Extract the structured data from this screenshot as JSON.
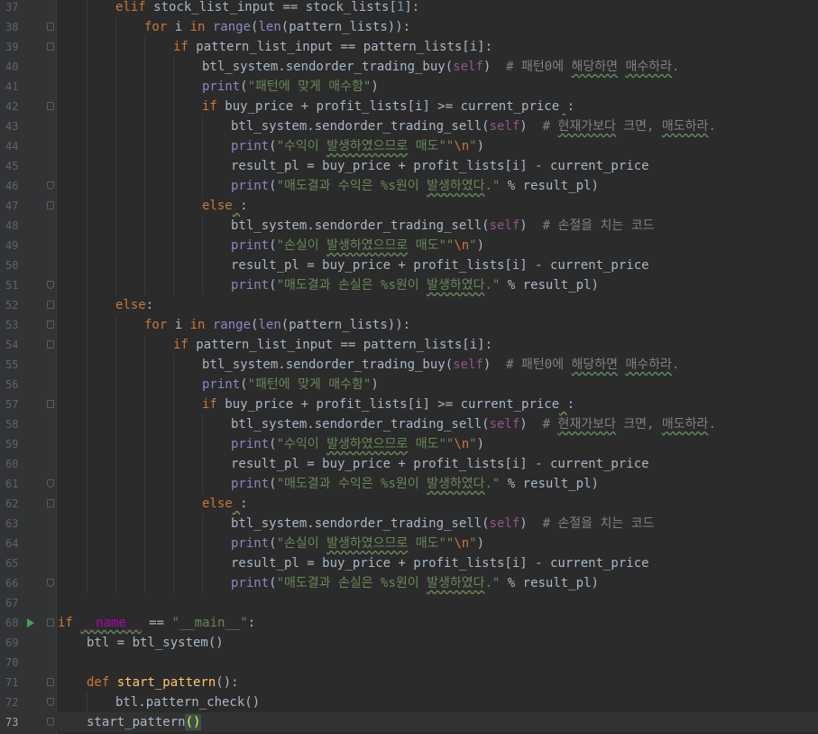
{
  "editor": {
    "lines": [
      {
        "num": "37",
        "indent": 2,
        "fold": "none",
        "tokens": [
          [
            "kw",
            "elif "
          ],
          [
            "",
            "stock_list_input == stock_lists["
          ],
          [
            "num",
            "1"
          ],
          [
            "",
            "]:"
          ]
        ]
      },
      {
        "num": "38",
        "indent": 3,
        "fold": "open",
        "tokens": [
          [
            "kw",
            "for "
          ],
          [
            "",
            "i "
          ],
          [
            "kw",
            "in "
          ],
          [
            "bi",
            "range"
          ],
          [
            "",
            "("
          ],
          [
            "bi",
            "len"
          ],
          [
            "",
            "(pattern_lists)):"
          ]
        ]
      },
      {
        "num": "39",
        "indent": 4,
        "fold": "open",
        "tokens": [
          [
            "kw",
            "if "
          ],
          [
            "",
            "pattern_list_input == pattern_lists[i]:"
          ]
        ]
      },
      {
        "num": "40",
        "indent": 5,
        "fold": "none",
        "tokens": [
          [
            "",
            "btl_system.sendorder_trading_buy("
          ],
          [
            "self",
            "self"
          ],
          [
            "",
            ")  "
          ],
          [
            "cmt",
            "# 패턴0에 "
          ],
          [
            "cmtu",
            "해당하면"
          ],
          [
            "cmt",
            " "
          ],
          [
            "cmtu",
            "매수하라"
          ],
          [
            "cmt",
            "."
          ]
        ]
      },
      {
        "num": "41",
        "indent": 5,
        "fold": "none",
        "tokens": [
          [
            "bi",
            "print"
          ],
          [
            "",
            "("
          ],
          [
            "str",
            "\"패턴에 맞게 매수함\""
          ],
          [
            "",
            ")"
          ]
        ]
      },
      {
        "num": "42",
        "indent": 5,
        "fold": "open",
        "tokens": [
          [
            "kw",
            "if "
          ],
          [
            "",
            "buy_price + profit_lists[i] >= current_price"
          ],
          [
            "warn",
            " "
          ],
          [
            "",
            ":"
          ]
        ]
      },
      {
        "num": "43",
        "indent": 6,
        "fold": "none",
        "tokens": [
          [
            "",
            "btl_system.sendorder_trading_sell("
          ],
          [
            "self",
            "self"
          ],
          [
            "",
            ")  "
          ],
          [
            "cmt",
            "# "
          ],
          [
            "cmtu",
            "현재가보다"
          ],
          [
            "cmt",
            " 크면, "
          ],
          [
            "cmtu",
            "매도하라"
          ],
          [
            "cmt",
            "."
          ]
        ]
      },
      {
        "num": "44",
        "indent": 6,
        "fold": "none",
        "tokens": [
          [
            "bi",
            "print"
          ],
          [
            "",
            "("
          ],
          [
            "str",
            "\"수익이 "
          ],
          [
            "stru",
            "발생하였으므로"
          ],
          [
            "str",
            " 매도\"\""
          ],
          [
            "esc",
            "\\n"
          ],
          [
            "str",
            "\""
          ],
          [
            "",
            ")"
          ]
        ]
      },
      {
        "num": "45",
        "indent": 6,
        "fold": "none",
        "tokens": [
          [
            "",
            "result_pl = buy_price + profit_lists[i] - current_price"
          ]
        ]
      },
      {
        "num": "46",
        "indent": 6,
        "fold": "end",
        "tokens": [
          [
            "bi",
            "print"
          ],
          [
            "",
            "("
          ],
          [
            "str",
            "\"매도결과 수익은 %s원이 "
          ],
          [
            "stru",
            "발생하였다"
          ],
          [
            "str",
            ".\""
          ],
          [
            "",
            " % result_pl)"
          ]
        ]
      },
      {
        "num": "47",
        "indent": 5,
        "fold": "open",
        "tokens": [
          [
            "kw",
            "else"
          ],
          [
            "warn",
            " "
          ],
          [
            "",
            ":"
          ]
        ]
      },
      {
        "num": "48",
        "indent": 6,
        "fold": "none",
        "tokens": [
          [
            "",
            "btl_system.sendorder_trading_sell("
          ],
          [
            "self",
            "self"
          ],
          [
            "",
            ")  "
          ],
          [
            "cmt",
            "# 손절을 치는 코드"
          ]
        ]
      },
      {
        "num": "49",
        "indent": 6,
        "fold": "none",
        "tokens": [
          [
            "bi",
            "print"
          ],
          [
            "",
            "("
          ],
          [
            "str",
            "\"손실이 "
          ],
          [
            "stru",
            "발생하였으므로"
          ],
          [
            "str",
            " 매도\"\""
          ],
          [
            "esc",
            "\\n"
          ],
          [
            "str",
            "\""
          ],
          [
            "",
            ")"
          ]
        ]
      },
      {
        "num": "50",
        "indent": 6,
        "fold": "none",
        "tokens": [
          [
            "",
            "result_pl = buy_price + profit_lists[i] - current_price"
          ]
        ]
      },
      {
        "num": "51",
        "indent": 6,
        "fold": "end",
        "tokens": [
          [
            "bi",
            "print"
          ],
          [
            "",
            "("
          ],
          [
            "str",
            "\"매도결과 손실은 %s원이 "
          ],
          [
            "stru",
            "발생하였다"
          ],
          [
            "str",
            ".\""
          ],
          [
            "",
            " % result_pl)"
          ]
        ]
      },
      {
        "num": "52",
        "indent": 2,
        "fold": "open",
        "tokens": [
          [
            "kw",
            "else"
          ],
          [
            "",
            ":"
          ]
        ]
      },
      {
        "num": "53",
        "indent": 3,
        "fold": "open",
        "tokens": [
          [
            "kw",
            "for "
          ],
          [
            "",
            "i "
          ],
          [
            "kw",
            "in "
          ],
          [
            "bi",
            "range"
          ],
          [
            "",
            "("
          ],
          [
            "bi",
            "len"
          ],
          [
            "",
            "(pattern_lists)):"
          ]
        ]
      },
      {
        "num": "54",
        "indent": 4,
        "fold": "open",
        "tokens": [
          [
            "kw",
            "if "
          ],
          [
            "",
            "pattern_list_input == pattern_lists[i]:"
          ]
        ]
      },
      {
        "num": "55",
        "indent": 5,
        "fold": "none",
        "tokens": [
          [
            "",
            "btl_system.sendorder_trading_buy("
          ],
          [
            "self",
            "self"
          ],
          [
            "",
            ")  "
          ],
          [
            "cmt",
            "# 패턴0에 "
          ],
          [
            "cmtu",
            "해당하면"
          ],
          [
            "cmt",
            " "
          ],
          [
            "cmtu",
            "매수하라"
          ],
          [
            "cmt",
            "."
          ]
        ]
      },
      {
        "num": "56",
        "indent": 5,
        "fold": "none",
        "tokens": [
          [
            "bi",
            "print"
          ],
          [
            "",
            "("
          ],
          [
            "str",
            "\"패턴에 맞게 매수함\""
          ],
          [
            "",
            ")"
          ]
        ]
      },
      {
        "num": "57",
        "indent": 5,
        "fold": "open",
        "tokens": [
          [
            "kw",
            "if "
          ],
          [
            "",
            "buy_price + profit_lists[i] >= current_price"
          ],
          [
            "warn",
            " "
          ],
          [
            "",
            ":"
          ]
        ]
      },
      {
        "num": "58",
        "indent": 6,
        "fold": "none",
        "tokens": [
          [
            "",
            "btl_system.sendorder_trading_sell("
          ],
          [
            "self",
            "self"
          ],
          [
            "",
            ")  "
          ],
          [
            "cmt",
            "# "
          ],
          [
            "cmtu",
            "현재가보다"
          ],
          [
            "cmt",
            " 크면, "
          ],
          [
            "cmtu",
            "매도하라"
          ],
          [
            "cmt",
            "."
          ]
        ]
      },
      {
        "num": "59",
        "indent": 6,
        "fold": "none",
        "tokens": [
          [
            "bi",
            "print"
          ],
          [
            "",
            "("
          ],
          [
            "str",
            "\"수익이 "
          ],
          [
            "stru",
            "발생하였으므로"
          ],
          [
            "str",
            " 매도\"\""
          ],
          [
            "esc",
            "\\n"
          ],
          [
            "str",
            "\""
          ],
          [
            "",
            ")"
          ]
        ]
      },
      {
        "num": "60",
        "indent": 6,
        "fold": "none",
        "tokens": [
          [
            "",
            "result_pl = buy_price + profit_lists[i] - current_price"
          ]
        ]
      },
      {
        "num": "61",
        "indent": 6,
        "fold": "end",
        "tokens": [
          [
            "bi",
            "print"
          ],
          [
            "",
            "("
          ],
          [
            "str",
            "\"매도결과 수익은 %s원이 "
          ],
          [
            "stru",
            "발생하였다"
          ],
          [
            "str",
            ".\""
          ],
          [
            "",
            " % result_pl)"
          ]
        ]
      },
      {
        "num": "62",
        "indent": 5,
        "fold": "open",
        "tokens": [
          [
            "kw",
            "else"
          ],
          [
            "warn",
            " "
          ],
          [
            "",
            ":"
          ]
        ]
      },
      {
        "num": "63",
        "indent": 6,
        "fold": "none",
        "tokens": [
          [
            "",
            "btl_system.sendorder_trading_sell("
          ],
          [
            "self",
            "self"
          ],
          [
            "",
            ")  "
          ],
          [
            "cmt",
            "# 손절을 치는 코드"
          ]
        ]
      },
      {
        "num": "64",
        "indent": 6,
        "fold": "none",
        "tokens": [
          [
            "bi",
            "print"
          ],
          [
            "",
            "("
          ],
          [
            "str",
            "\"손실이 "
          ],
          [
            "stru",
            "발생하였으므로"
          ],
          [
            "str",
            " 매도\"\""
          ],
          [
            "esc",
            "\\n"
          ],
          [
            "str",
            "\""
          ],
          [
            "",
            ")"
          ]
        ]
      },
      {
        "num": "65",
        "indent": 6,
        "fold": "none",
        "tokens": [
          [
            "",
            "result_pl = buy_price + profit_lists[i] - current_price"
          ]
        ]
      },
      {
        "num": "66",
        "indent": 6,
        "fold": "end",
        "tokens": [
          [
            "bi",
            "print"
          ],
          [
            "",
            "("
          ],
          [
            "str",
            "\"매도결과 손실은 %s원이 "
          ],
          [
            "stru",
            "발생하였다"
          ],
          [
            "str",
            ".\""
          ],
          [
            "",
            " % result_pl)"
          ]
        ]
      },
      {
        "num": "67",
        "indent": 0,
        "fold": "none",
        "tokens": []
      },
      {
        "num": "68",
        "indent": 0,
        "fold": "open",
        "run": true,
        "tokens": [
          [
            "kw",
            "if "
          ],
          [
            "dunder",
            "__name__"
          ],
          [
            "",
            " == "
          ],
          [
            "str",
            "\"__main__\""
          ],
          [
            "",
            ":"
          ]
        ]
      },
      {
        "num": "69",
        "indent": 1,
        "fold": "none",
        "tokens": [
          [
            "",
            "btl = btl_system()"
          ]
        ]
      },
      {
        "num": "70",
        "indent": 0,
        "fold": "none",
        "tokens": []
      },
      {
        "num": "71",
        "indent": 1,
        "fold": "open",
        "tokens": [
          [
            "kw",
            "def "
          ],
          [
            "fn",
            "start_pattern"
          ],
          [
            "",
            "():"
          ]
        ]
      },
      {
        "num": "72",
        "indent": 2,
        "fold": "end",
        "tokens": [
          [
            "",
            "btl.pattern_check()"
          ]
        ]
      },
      {
        "num": "73",
        "indent": 1,
        "fold": "end",
        "current": true,
        "tokens": [
          [
            "",
            "start_pattern"
          ],
          [
            "caret",
            "()"
          ]
        ]
      }
    ]
  },
  "colors": {
    "background": "#2b2b2b",
    "gutter": "#313335",
    "keyword": "#cc7832",
    "builtin": "#8888c6",
    "string": "#6a8759",
    "comment": "#808080",
    "self": "#94558d",
    "function": "#ffc66d",
    "number": "#6897bb",
    "run_icon": "#499c54"
  },
  "icons": {
    "fold": "fold-marker-icon",
    "run": "run-gutter-icon"
  }
}
